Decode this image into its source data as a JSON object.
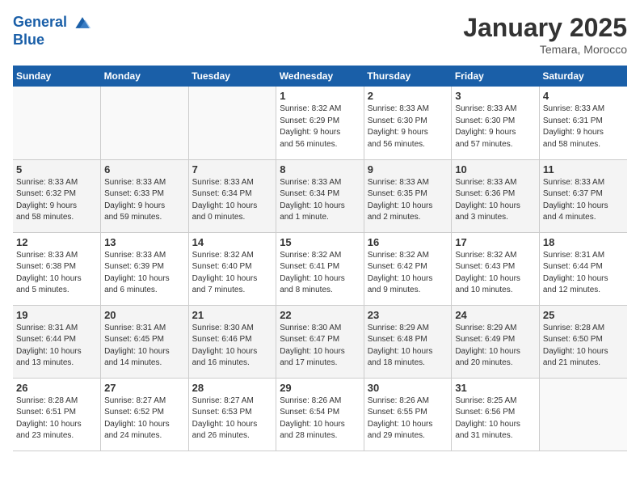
{
  "header": {
    "logo_line1": "General",
    "logo_line2": "Blue",
    "month_title": "January 2025",
    "location": "Temara, Morocco"
  },
  "weekdays": [
    "Sunday",
    "Monday",
    "Tuesday",
    "Wednesday",
    "Thursday",
    "Friday",
    "Saturday"
  ],
  "weeks": [
    [
      {
        "day": "",
        "info": ""
      },
      {
        "day": "",
        "info": ""
      },
      {
        "day": "",
        "info": ""
      },
      {
        "day": "1",
        "info": "Sunrise: 8:32 AM\nSunset: 6:29 PM\nDaylight: 9 hours\nand 56 minutes."
      },
      {
        "day": "2",
        "info": "Sunrise: 8:33 AM\nSunset: 6:30 PM\nDaylight: 9 hours\nand 56 minutes."
      },
      {
        "day": "3",
        "info": "Sunrise: 8:33 AM\nSunset: 6:30 PM\nDaylight: 9 hours\nand 57 minutes."
      },
      {
        "day": "4",
        "info": "Sunrise: 8:33 AM\nSunset: 6:31 PM\nDaylight: 9 hours\nand 58 minutes."
      }
    ],
    [
      {
        "day": "5",
        "info": "Sunrise: 8:33 AM\nSunset: 6:32 PM\nDaylight: 9 hours\nand 58 minutes."
      },
      {
        "day": "6",
        "info": "Sunrise: 8:33 AM\nSunset: 6:33 PM\nDaylight: 9 hours\nand 59 minutes."
      },
      {
        "day": "7",
        "info": "Sunrise: 8:33 AM\nSunset: 6:34 PM\nDaylight: 10 hours\nand 0 minutes."
      },
      {
        "day": "8",
        "info": "Sunrise: 8:33 AM\nSunset: 6:34 PM\nDaylight: 10 hours\nand 1 minute."
      },
      {
        "day": "9",
        "info": "Sunrise: 8:33 AM\nSunset: 6:35 PM\nDaylight: 10 hours\nand 2 minutes."
      },
      {
        "day": "10",
        "info": "Sunrise: 8:33 AM\nSunset: 6:36 PM\nDaylight: 10 hours\nand 3 minutes."
      },
      {
        "day": "11",
        "info": "Sunrise: 8:33 AM\nSunset: 6:37 PM\nDaylight: 10 hours\nand 4 minutes."
      }
    ],
    [
      {
        "day": "12",
        "info": "Sunrise: 8:33 AM\nSunset: 6:38 PM\nDaylight: 10 hours\nand 5 minutes."
      },
      {
        "day": "13",
        "info": "Sunrise: 8:33 AM\nSunset: 6:39 PM\nDaylight: 10 hours\nand 6 minutes."
      },
      {
        "day": "14",
        "info": "Sunrise: 8:32 AM\nSunset: 6:40 PM\nDaylight: 10 hours\nand 7 minutes."
      },
      {
        "day": "15",
        "info": "Sunrise: 8:32 AM\nSunset: 6:41 PM\nDaylight: 10 hours\nand 8 minutes."
      },
      {
        "day": "16",
        "info": "Sunrise: 8:32 AM\nSunset: 6:42 PM\nDaylight: 10 hours\nand 9 minutes."
      },
      {
        "day": "17",
        "info": "Sunrise: 8:32 AM\nSunset: 6:43 PM\nDaylight: 10 hours\nand 10 minutes."
      },
      {
        "day": "18",
        "info": "Sunrise: 8:31 AM\nSunset: 6:44 PM\nDaylight: 10 hours\nand 12 minutes."
      }
    ],
    [
      {
        "day": "19",
        "info": "Sunrise: 8:31 AM\nSunset: 6:44 PM\nDaylight: 10 hours\nand 13 minutes."
      },
      {
        "day": "20",
        "info": "Sunrise: 8:31 AM\nSunset: 6:45 PM\nDaylight: 10 hours\nand 14 minutes."
      },
      {
        "day": "21",
        "info": "Sunrise: 8:30 AM\nSunset: 6:46 PM\nDaylight: 10 hours\nand 16 minutes."
      },
      {
        "day": "22",
        "info": "Sunrise: 8:30 AM\nSunset: 6:47 PM\nDaylight: 10 hours\nand 17 minutes."
      },
      {
        "day": "23",
        "info": "Sunrise: 8:29 AM\nSunset: 6:48 PM\nDaylight: 10 hours\nand 18 minutes."
      },
      {
        "day": "24",
        "info": "Sunrise: 8:29 AM\nSunset: 6:49 PM\nDaylight: 10 hours\nand 20 minutes."
      },
      {
        "day": "25",
        "info": "Sunrise: 8:28 AM\nSunset: 6:50 PM\nDaylight: 10 hours\nand 21 minutes."
      }
    ],
    [
      {
        "day": "26",
        "info": "Sunrise: 8:28 AM\nSunset: 6:51 PM\nDaylight: 10 hours\nand 23 minutes."
      },
      {
        "day": "27",
        "info": "Sunrise: 8:27 AM\nSunset: 6:52 PM\nDaylight: 10 hours\nand 24 minutes."
      },
      {
        "day": "28",
        "info": "Sunrise: 8:27 AM\nSunset: 6:53 PM\nDaylight: 10 hours\nand 26 minutes."
      },
      {
        "day": "29",
        "info": "Sunrise: 8:26 AM\nSunset: 6:54 PM\nDaylight: 10 hours\nand 28 minutes."
      },
      {
        "day": "30",
        "info": "Sunrise: 8:26 AM\nSunset: 6:55 PM\nDaylight: 10 hours\nand 29 minutes."
      },
      {
        "day": "31",
        "info": "Sunrise: 8:25 AM\nSunset: 6:56 PM\nDaylight: 10 hours\nand 31 minutes."
      },
      {
        "day": "",
        "info": ""
      }
    ]
  ]
}
